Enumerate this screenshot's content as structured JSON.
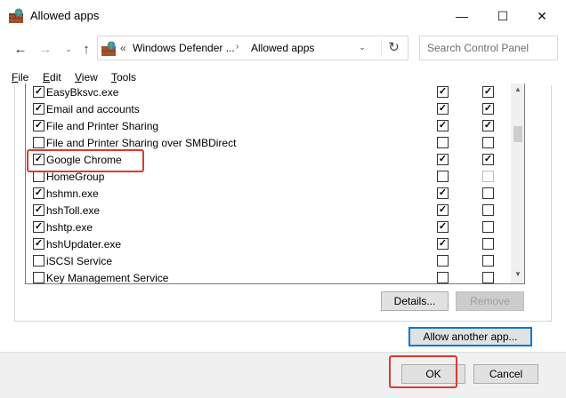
{
  "window": {
    "title": "Allowed apps",
    "controls": {
      "minimize": "—",
      "maximize": "☐",
      "close": "✕"
    }
  },
  "nav": {
    "back": "←",
    "forward": "→",
    "dropdown": "⌄",
    "up": "↑",
    "address": {
      "prefix": "«",
      "crumb1": "Windows Defender ...",
      "arrow": "›",
      "crumb2": "Allowed apps",
      "dropdown": "⌄",
      "refresh": "↻"
    },
    "search_placeholder": "Search Control Panel"
  },
  "menu": {
    "file": {
      "u": "F",
      "rest": "ile"
    },
    "edit": {
      "u": "E",
      "rest": "dit"
    },
    "view": {
      "u": "V",
      "rest": "iew"
    },
    "tools": {
      "u": "T",
      "rest": "ools"
    }
  },
  "apps": [
    {
      "name": "EasyBksvc.exe",
      "enabled": true,
      "private": true,
      "public": true,
      "public_disabled": false
    },
    {
      "name": "Email and accounts",
      "enabled": true,
      "private": true,
      "public": true,
      "public_disabled": false
    },
    {
      "name": "File and Printer Sharing",
      "enabled": true,
      "private": true,
      "public": true,
      "public_disabled": false
    },
    {
      "name": "File and Printer Sharing over SMBDirect",
      "enabled": false,
      "private": false,
      "public": false,
      "public_disabled": false
    },
    {
      "name": "Google Chrome",
      "enabled": true,
      "private": true,
      "public": true,
      "public_disabled": false
    },
    {
      "name": "HomeGroup",
      "enabled": false,
      "private": false,
      "public": false,
      "public_disabled": true
    },
    {
      "name": "hshmn.exe",
      "enabled": true,
      "private": true,
      "public": false,
      "public_disabled": false
    },
    {
      "name": "hshToll.exe",
      "enabled": true,
      "private": true,
      "public": false,
      "public_disabled": false
    },
    {
      "name": "hshtp.exe",
      "enabled": true,
      "private": true,
      "public": false,
      "public_disabled": false
    },
    {
      "name": "hshUpdater.exe",
      "enabled": true,
      "private": true,
      "public": false,
      "public_disabled": false
    },
    {
      "name": "iSCSI Service",
      "enabled": false,
      "private": false,
      "public": false,
      "public_disabled": false
    },
    {
      "name": "Key Management Service",
      "enabled": false,
      "private": false,
      "public": false,
      "public_disabled": false
    }
  ],
  "scroll": {
    "up": "▲",
    "down": "▼"
  },
  "buttons": {
    "details": "Details...",
    "remove": "Remove",
    "allow_another": "Allow another app...",
    "ok": "OK",
    "cancel": "Cancel"
  },
  "colors": {
    "highlight": "#d83a34",
    "focus": "#0078d7"
  }
}
